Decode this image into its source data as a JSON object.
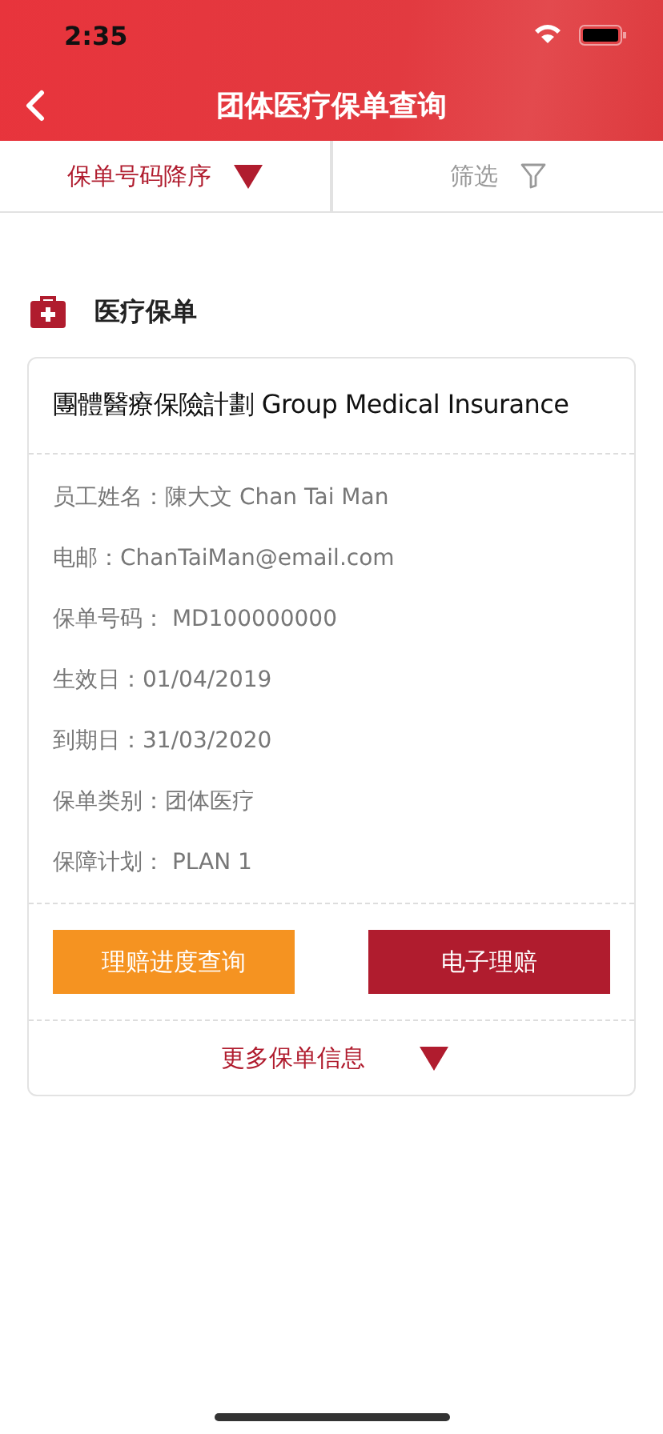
{
  "status_bar": {
    "time": "2:35"
  },
  "nav": {
    "title": "团体医疗保单查询"
  },
  "tabs": [
    {
      "label": "保单号码降序",
      "kind": "sort",
      "selected": true
    },
    {
      "label": "筛选",
      "kind": "filter",
      "selected": false
    }
  ],
  "section": {
    "title": "医疗保单"
  },
  "card": {
    "title": "團體醫療保險計劃 Group Medical Insurance",
    "fields": [
      "员工姓名：陳大文 Chan Tai Man",
      "电邮：ChanTaiMan@email.com",
      "保单号码： MD100000000",
      "生效日：01/04/2019",
      "到期日：31/03/2020",
      "保单类别：团体医疗",
      "保障计划： PLAN 1"
    ],
    "buttons": [
      {
        "label": "理赔进度查询",
        "kind": "secondary"
      },
      {
        "label": "电子理赔",
        "kind": "primary"
      }
    ],
    "more": "更多保单信息"
  }
}
